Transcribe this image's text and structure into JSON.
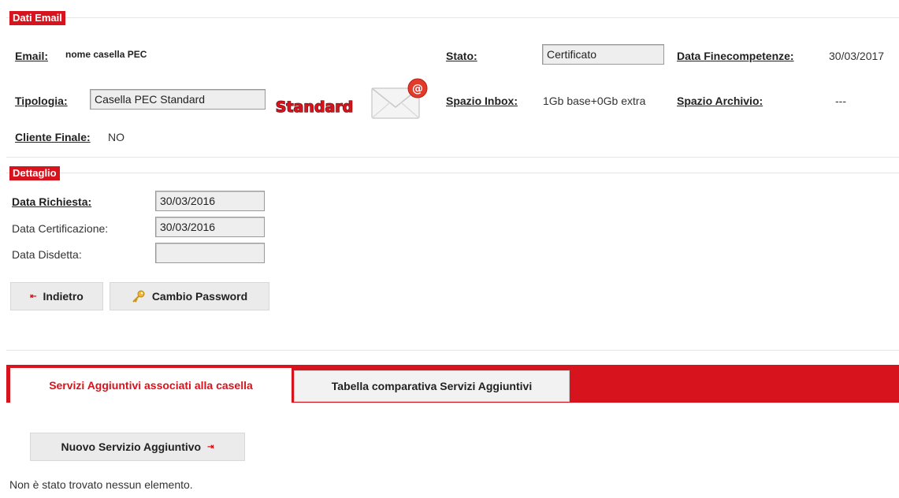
{
  "dati_email": {
    "section_title": "Dati Email",
    "email_label": "Email:",
    "email_value": "nome casella PEC",
    "stato_label": "Stato:",
    "stato_value": "Certificato",
    "data_fine_label": "Data Finecompetenze:",
    "data_fine_value": "30/03/2017",
    "tipologia_label": "Tipologia:",
    "tipologia_value": "Casella PEC Standard",
    "standard_badge": "Standard",
    "spazio_inbox_label": "Spazio Inbox:",
    "spazio_inbox_value": "1Gb base+0Gb extra",
    "spazio_archivio_label": "Spazio Archivio:",
    "spazio_archivio_value": "---",
    "cliente_finale_label": "Cliente Finale:",
    "cliente_finale_value": "NO"
  },
  "dettaglio": {
    "section_title": "Dettaglio",
    "data_richiesta_label": "Data Richiesta:",
    "data_richiesta_value": "30/03/2016",
    "data_certificazione_label": "Data Certificazione:",
    "data_certificazione_value": "30/03/2016",
    "data_disdetta_label": "Data Disdetta:",
    "data_disdetta_value": ""
  },
  "buttons": {
    "indietro": "Indietro",
    "cambio_password": "Cambio Password"
  },
  "tabs": [
    {
      "label": "Servizi Aggiuntivi associati alla casella",
      "active": true
    },
    {
      "label": "Tabella comparativa Servizi Aggiuntivi",
      "active": false
    }
  ],
  "servizi": {
    "new_button": "Nuovo Servizio Aggiuntivo",
    "empty_message": "Non è stato trovato nessun elemento."
  },
  "colors": {
    "accent": "#d7141d",
    "field_bg": "#eeeeee",
    "button_bg": "#ebebeb"
  }
}
